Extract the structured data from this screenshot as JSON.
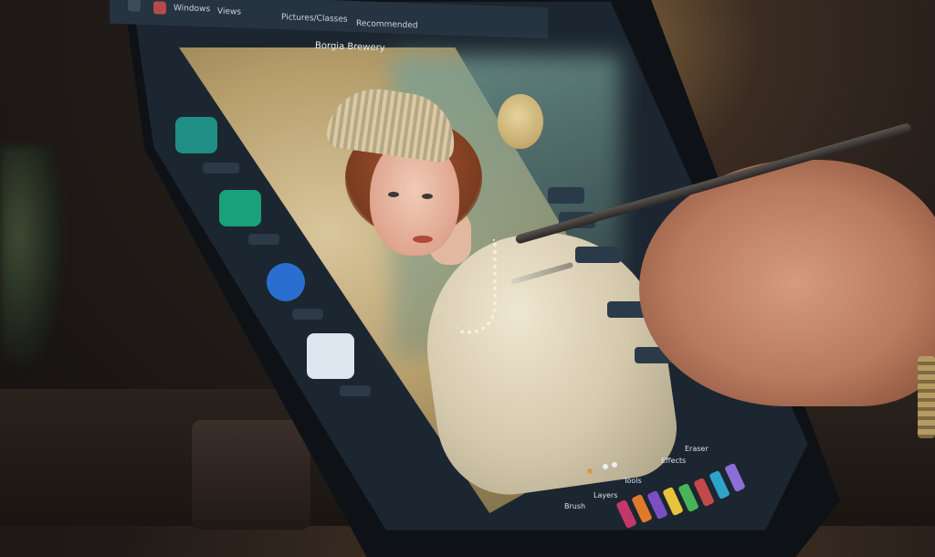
{
  "scene": {
    "background": "#211b18"
  },
  "topbar": {
    "items": [
      "Pictures/Classes",
      "Recommended",
      "Windows",
      "Views"
    ]
  },
  "canvas": {
    "title": "Borgia Brewery"
  },
  "bottom_toolbar": {
    "labels": [
      "Brush",
      "Layers",
      "Tools",
      "Effects",
      "Eraser"
    ],
    "swatch_colors": [
      "#7a4fc2",
      "#c2386a",
      "#e07a2b",
      "#e8c43a",
      "#49b35a",
      "#2fa3c9",
      "#c44a4a",
      "#8b6fd6"
    ]
  },
  "sidebar": {
    "button_colors": [
      "#1f8f86",
      "#1aa07a",
      "#2a6fd0",
      "#dde6ee"
    ]
  }
}
